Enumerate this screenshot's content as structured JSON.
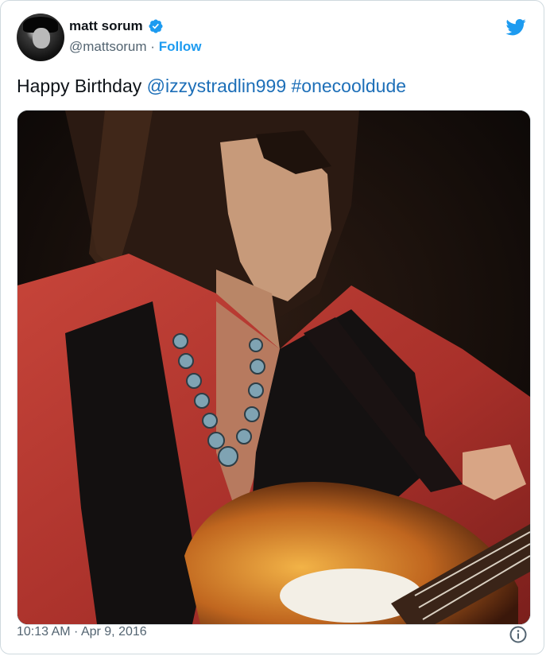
{
  "user": {
    "display_name": "matt sorum",
    "handle": "@mattsorum",
    "separator": "·",
    "follow_label": "Follow",
    "verified_icon": "verified-badge-icon",
    "avatar_icon": "avatar"
  },
  "tweet": {
    "text_plain": "Happy Birthday ",
    "mention": "@izzystradlin999",
    "hashtag": "#onecooldude"
  },
  "media": {
    "alt": "Photo of guitarist in red shirt, black vest and beaded necklace playing a sunburst guitar"
  },
  "footer": {
    "timestamp": "10:13 AM · Apr 9, 2016",
    "info_icon": "info-icon"
  },
  "colors": {
    "brand_blue": "#1d9bf0",
    "link_blue": "#1d6fb8",
    "text_primary": "#0f1419",
    "text_secondary": "#536471",
    "border": "#cfd9de"
  }
}
